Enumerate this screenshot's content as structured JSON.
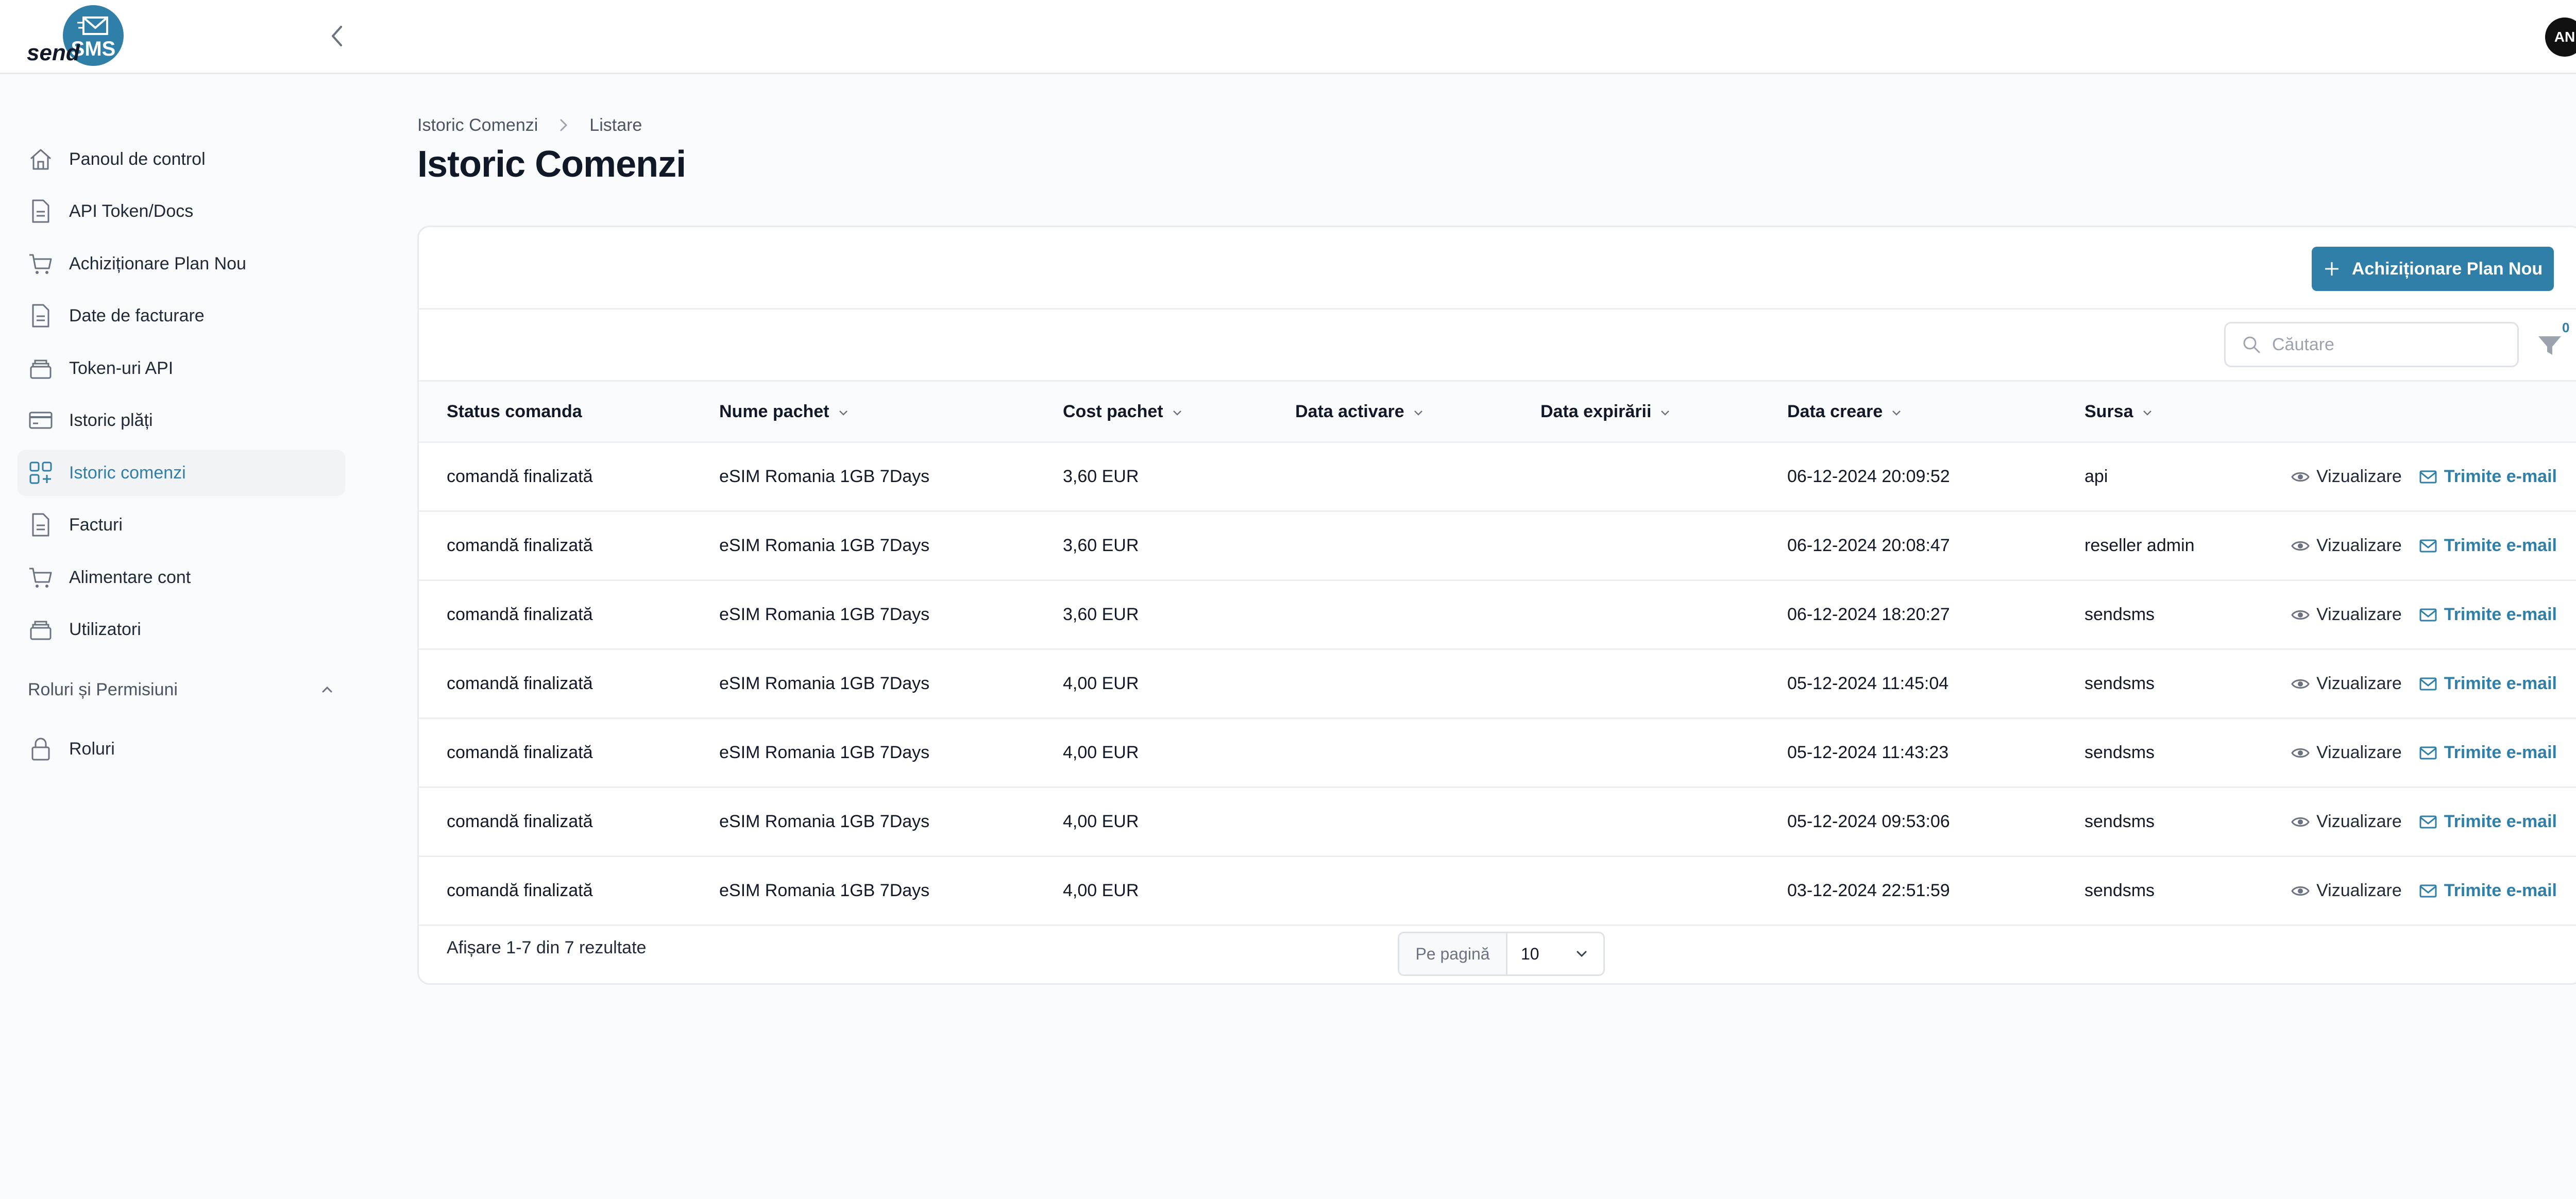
{
  "app": {
    "logo_text_send": "send",
    "logo_text_sms": "SMS",
    "avatar_initials": "AN",
    "accent_color": "#2f7fa8"
  },
  "sidebar": {
    "items": [
      {
        "label": "Panoul de control",
        "icon": "home-icon"
      },
      {
        "label": "API Token/Docs",
        "icon": "document-icon"
      },
      {
        "label": "Achiziționare Plan Nou",
        "icon": "cart-icon"
      },
      {
        "label": "Date de facturare",
        "icon": "document-icon"
      },
      {
        "label": "Token-uri API",
        "icon": "stack-icon"
      },
      {
        "label": "Istoric plăți",
        "icon": "credit-card-icon"
      },
      {
        "label": "Istoric comenzi",
        "icon": "grid-plus-icon"
      },
      {
        "label": "Facturi",
        "icon": "document-icon"
      },
      {
        "label": "Alimentare cont",
        "icon": "cart-icon"
      },
      {
        "label": "Utilizatori",
        "icon": "stack-icon"
      }
    ],
    "section_title": "Roluri și Permisiuni",
    "section_items": [
      {
        "label": "Roluri",
        "icon": "lock-icon"
      }
    ]
  },
  "breadcrumb": {
    "root": "Istoric Comenzi",
    "current": "Listare"
  },
  "page_title": "Istoric Comenzi",
  "toolbar": {
    "new_plan_label": "Achiziționare Plan Nou",
    "search_placeholder": "Căutare",
    "filter_count": "0"
  },
  "table": {
    "columns": [
      "Status comanda",
      "Nume pachet",
      "Cost pachet",
      "Data activare",
      "Data expirării",
      "Data creare",
      "Sursa"
    ],
    "view_label": "Vizualizare",
    "email_label": "Trimite e-mail",
    "rows": [
      {
        "status": "comandă finalizată",
        "package": "eSIM Romania 1GB 7Days",
        "cost": "3,60 EUR",
        "activation": "",
        "expiry": "",
        "created": "06-12-2024 20:09:52",
        "source": "api"
      },
      {
        "status": "comandă finalizată",
        "package": "eSIM Romania 1GB 7Days",
        "cost": "3,60 EUR",
        "activation": "",
        "expiry": "",
        "created": "06-12-2024 20:08:47",
        "source": "reseller admin"
      },
      {
        "status": "comandă finalizată",
        "package": "eSIM Romania 1GB 7Days",
        "cost": "3,60 EUR",
        "activation": "",
        "expiry": "",
        "created": "06-12-2024 18:20:27",
        "source": "sendsms"
      },
      {
        "status": "comandă finalizată",
        "package": "eSIM Romania 1GB 7Days",
        "cost": "4,00 EUR",
        "activation": "",
        "expiry": "",
        "created": "05-12-2024 11:45:04",
        "source": "sendsms"
      },
      {
        "status": "comandă finalizată",
        "package": "eSIM Romania 1GB 7Days",
        "cost": "4,00 EUR",
        "activation": "",
        "expiry": "",
        "created": "05-12-2024 11:43:23",
        "source": "sendsms"
      },
      {
        "status": "comandă finalizată",
        "package": "eSIM Romania 1GB 7Days",
        "cost": "4,00 EUR",
        "activation": "",
        "expiry": "",
        "created": "05-12-2024 09:53:06",
        "source": "sendsms"
      },
      {
        "status": "comandă finalizată",
        "package": "eSIM Romania 1GB 7Days",
        "cost": "4,00 EUR",
        "activation": "",
        "expiry": "",
        "created": "03-12-2024 22:51:59",
        "source": "sendsms"
      }
    ]
  },
  "pagination": {
    "results_text": "Afișare 1-7 din 7 rezultate",
    "per_page_label": "Pe pagină",
    "per_page_value": "10"
  }
}
